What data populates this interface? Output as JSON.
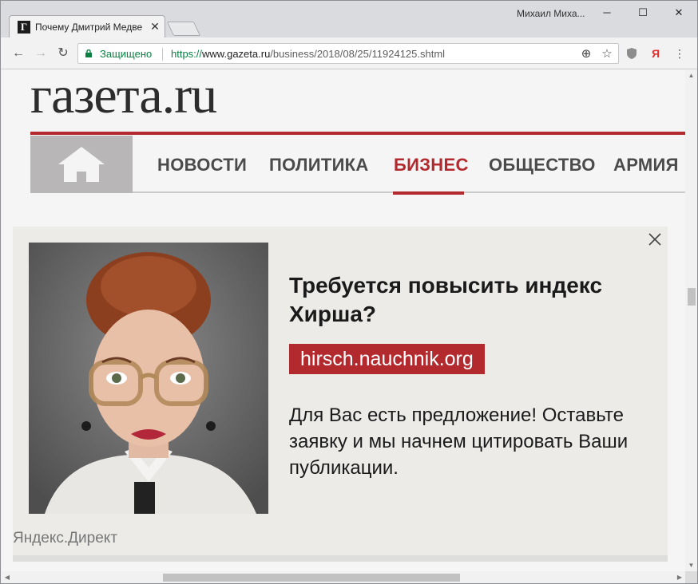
{
  "browser": {
    "tab": {
      "title": "Почему Дмитрий Медве",
      "favicon": "Г",
      "close": "✕"
    },
    "profile_name": "Михаил Миха...",
    "window_buttons": {
      "minimize": "─",
      "maximize": "☐",
      "close": "✕"
    },
    "nav": {
      "back": "←",
      "forward": "→",
      "reload": "↻"
    },
    "omnibox": {
      "secure_label": "Защищено",
      "url_scheme": "https://",
      "url_host": "www.gazeta.ru",
      "url_path": "/business/2018/08/25/11924125.shtml"
    },
    "icons": {
      "zoom": "⊕",
      "star": "☆",
      "yandex": "Я",
      "menu": "⋮"
    }
  },
  "site": {
    "logo": "газета.ru",
    "nav_items": [
      {
        "label": "НОВОСТИ"
      },
      {
        "label": "ПОЛИТИКА"
      },
      {
        "label": "БИЗНЕС",
        "active": true
      },
      {
        "label": "ОБЩЕСТВО"
      },
      {
        "label": "АРМИЯ"
      }
    ],
    "accent_color": "#b2292e"
  },
  "ad": {
    "title": "Требуется повысить индекс Хирша?",
    "link": "hirsch.nauchnik.org",
    "text": "Для Вас есть предложение! Оставьте заявку и мы начнем цитировать Ваши публикации.",
    "source": "Яндекс.Директ"
  },
  "scrollbar": {
    "up": "▲",
    "down": "▼",
    "left": "◀",
    "right": "▶"
  }
}
